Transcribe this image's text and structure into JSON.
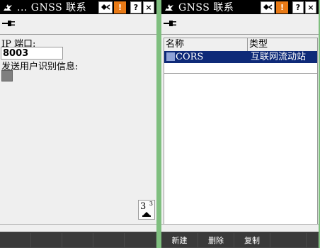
{
  "left": {
    "title": "... GNSS 联系",
    "port_label": "IP 端口:",
    "port_value": "8003",
    "send_id_label": "发送用户识别信息:",
    "page_current": "3",
    "page_total": "3",
    "softkeys": [
      "",
      "",
      "",
      "",
      ""
    ]
  },
  "right": {
    "title": "GNSS 联系",
    "table": {
      "headers": [
        "名称",
        "类型"
      ],
      "rows": [
        [
          "CORS",
          "互联网流动站"
        ]
      ]
    },
    "softkeys": [
      "新建",
      "删除",
      "复制",
      "",
      ""
    ]
  },
  "titlebar_buttons": {
    "help": "?",
    "close": "×",
    "warn": "!"
  },
  "colors": {
    "selection": "#0e2a78",
    "warning": "#e87a16",
    "titlebar": "#000000",
    "separator": "#7fbf7f"
  },
  "icons": [
    "window-icon",
    "satellite-icon",
    "warning-icon",
    "help-icon",
    "close-icon",
    "plug-icon",
    "page-indicator-arrow-icon"
  ]
}
